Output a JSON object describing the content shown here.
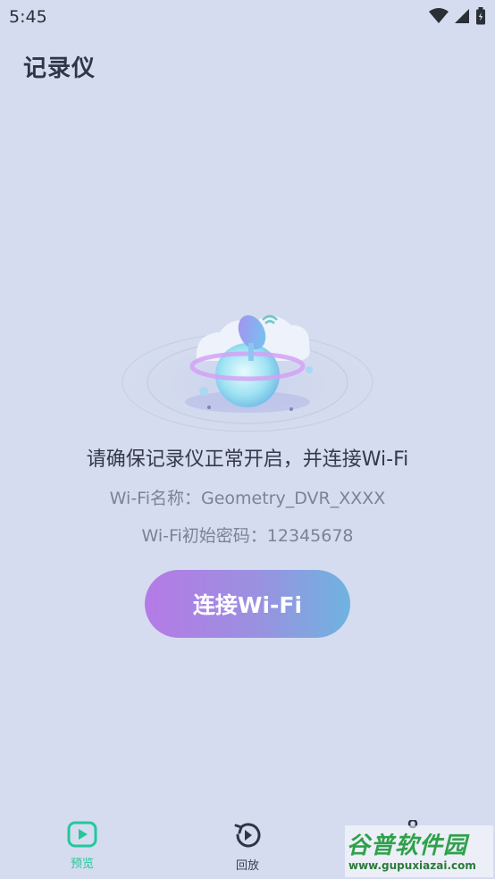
{
  "status_bar": {
    "time": "5:45"
  },
  "app_bar": {
    "title": "记录仪"
  },
  "main": {
    "instruction": "请确保记录仪正常开启，并连接Wi-Fi",
    "wifi_name": "Wi-Fi名称：Geometry_DVR_XXXX",
    "wifi_password": "Wi-Fi初始密码：12345678",
    "connect_label": "连接Wi-Fi"
  },
  "bottom_nav": {
    "items": [
      {
        "label": "预览",
        "icon": "play-square-icon",
        "active": true
      },
      {
        "label": "回放",
        "icon": "history-icon",
        "active": false
      },
      {
        "label": "",
        "icon": "settings-icon",
        "active": false
      }
    ]
  },
  "colors": {
    "background": "#d5dcef",
    "accent": "#24c79a",
    "button_gradient_start": "#b57ae6",
    "button_gradient_end": "#6fb3e0"
  },
  "watermark": {
    "title": "谷普软件园",
    "url": "www.gupuxiazai.com"
  }
}
